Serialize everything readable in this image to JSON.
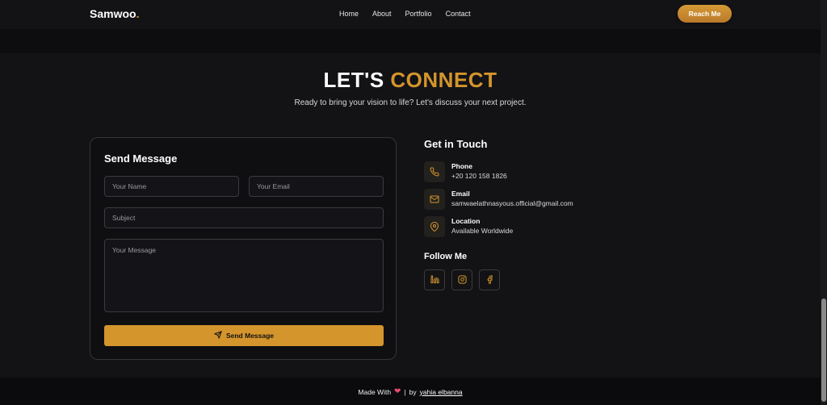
{
  "brand": {
    "name": "Samwoo",
    "dot": ".",
    "accent_color": "#d4952c"
  },
  "nav": {
    "links": [
      "Home",
      "About",
      "Portfolio",
      "Contact"
    ],
    "cta": "Reach Me"
  },
  "hero": {
    "title_main": "LET'S",
    "title_accent": "CONNECT",
    "subtitle": "Ready to bring your vision to life? Let's discuss your next project."
  },
  "form": {
    "title": "Send Message",
    "name_placeholder": "Your Name",
    "email_placeholder": "Your Email",
    "subject_placeholder": "Subject",
    "message_placeholder": "Your Message",
    "submit_label": "Send Message"
  },
  "contact": {
    "title": "Get in Touch",
    "items": [
      {
        "label": "Phone",
        "value": "+20 120 158 1826",
        "icon": "phone-icon"
      },
      {
        "label": "Email",
        "value": "samwaelathnasyous.official@gmail.com",
        "icon": "mail-icon"
      },
      {
        "label": "Location",
        "value": "Available Worldwide",
        "icon": "map-pin-icon"
      }
    ]
  },
  "social": {
    "title": "Follow Me",
    "icons": [
      "linkedin-icon",
      "instagram-icon",
      "facebook-icon"
    ]
  },
  "footer": {
    "made_with": "Made With",
    "separator": "|",
    "by": "by",
    "author": "yahia elbanna"
  }
}
